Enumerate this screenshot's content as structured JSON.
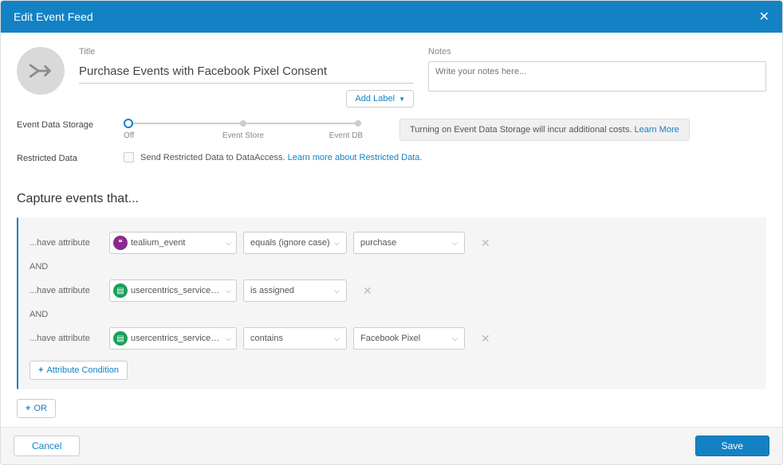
{
  "header": {
    "title": "Edit Event Feed"
  },
  "form": {
    "title_label": "Title",
    "title_value": "Purchase Events with Facebook Pixel Consent",
    "notes_label": "Notes",
    "notes_placeholder": "Write your notes here...",
    "add_label_btn": "Add Label"
  },
  "storage": {
    "label": "Event Data Storage",
    "slider": {
      "off": "Off",
      "mid": "Event Store",
      "right": "Event DB"
    },
    "warning_text": "Turning on Event Data Storage will incur additional costs. ",
    "warning_link": "Learn More"
  },
  "restricted": {
    "label": "Restricted Data",
    "text": "Send Restricted Data to DataAccess. ",
    "link": "Learn more about Restricted Data."
  },
  "section_title": "Capture events that...",
  "rules": {
    "have_attr": "...have attribute",
    "and_label": "AND",
    "r1": {
      "attr": "tealium_event",
      "op": "equals (ignore case)",
      "val": "purchase",
      "badge": "purple"
    },
    "r2": {
      "attr": "usercentrics_services_with_...",
      "op": "is assigned",
      "badge": "green"
    },
    "r3": {
      "attr": "usercentrics_services_with_...",
      "op": "contains",
      "val": "Facebook Pixel",
      "badge": "green"
    },
    "add_cond": "Attribute Condition",
    "or_btn": "OR"
  },
  "footer": {
    "cancel": "Cancel",
    "save": "Save"
  }
}
